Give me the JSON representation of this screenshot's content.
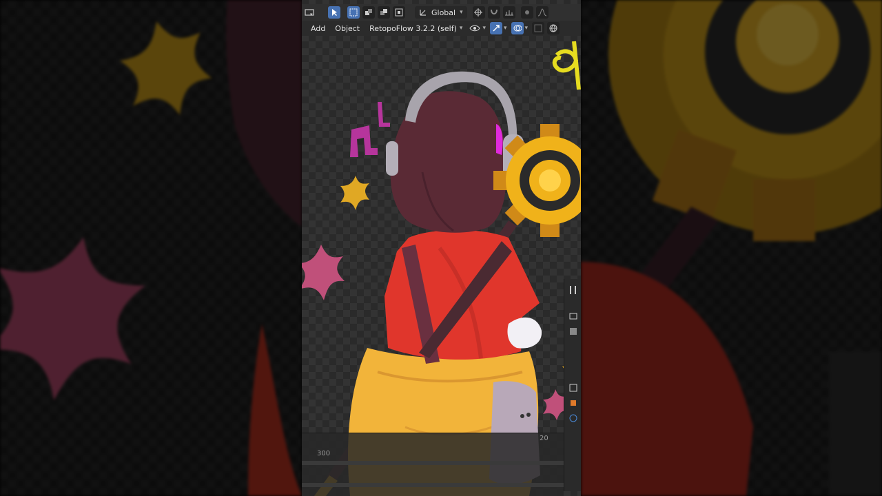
{
  "header": {
    "orientation_label": "Global",
    "menu_add": "Add",
    "menu_object": "Object",
    "addon_label": "RetopoFlow 3.2.2 (self)"
  },
  "timeline": {
    "frame_left": "300",
    "frame_right": "20"
  },
  "icons": [
    "viewport-shading-icon",
    "select-cursor-icon",
    "select-mode-icons",
    "transform-orientation-icon",
    "pivot-icon",
    "snap-icon",
    "proportional-edit-icon",
    "visibility-icon",
    "gizmo-icon",
    "overlay-icon",
    "xray-icon",
    "properties-tool-icon",
    "properties-render-icon",
    "properties-output-icon"
  ],
  "colors": {
    "ui_dark": "#303030",
    "accent_blue": "#4772b3",
    "shirt_red": "#e0362c",
    "cloak_yellow": "#f2b43a",
    "hair_brown": "#5a2a35",
    "gear_gold": "#f0b21a",
    "flower_pink": "#c0507a",
    "note_magenta": "#b6359c"
  }
}
